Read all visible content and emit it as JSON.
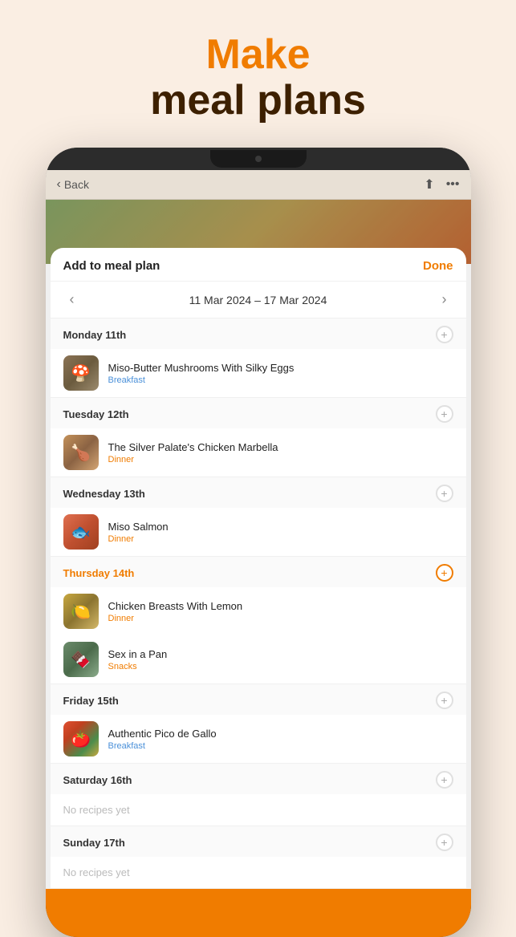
{
  "header": {
    "line1": "Make",
    "line2": "meal plans"
  },
  "app_bar": {
    "back_label": "Back",
    "share_icon": "share",
    "more_icon": "more"
  },
  "modal": {
    "title": "Add to meal plan",
    "done_label": "Done",
    "week_label": "11 Mar 2024 – 17 Mar 2024",
    "prev_arrow": "‹",
    "next_arrow": "›",
    "days": [
      {
        "id": "monday",
        "label": "Monday 11th",
        "is_highlighted": false,
        "recipes": [
          {
            "name": "Miso-Butter Mushrooms With Silky Eggs",
            "meal_type": "Breakfast",
            "meal_class": "meal-breakfast",
            "thumb_class": "thumb-mushroom",
            "emoji": "🍄"
          }
        ]
      },
      {
        "id": "tuesday",
        "label": "Tuesday 12th",
        "is_highlighted": false,
        "recipes": [
          {
            "name": "The Silver Palate's Chicken Marbella",
            "meal_type": "Dinner",
            "meal_class": "meal-dinner",
            "thumb_class": "thumb-chicken",
            "emoji": "🍗"
          }
        ]
      },
      {
        "id": "wednesday",
        "label": "Wednesday 13th",
        "is_highlighted": false,
        "recipes": [
          {
            "name": "Miso Salmon",
            "meal_type": "Dinner",
            "meal_class": "meal-dinner",
            "thumb_class": "thumb-salmon",
            "emoji": "🐟"
          }
        ]
      },
      {
        "id": "thursday",
        "label": "Thursday 14th",
        "is_highlighted": true,
        "recipes": [
          {
            "name": "Chicken Breasts With Lemon",
            "meal_type": "Dinner",
            "meal_class": "meal-dinner",
            "thumb_class": "thumb-lemon-chicken",
            "emoji": "🍋"
          },
          {
            "name": "Sex in a Pan",
            "meal_type": "Snacks",
            "meal_class": "meal-snacks",
            "thumb_class": "thumb-sex-in-pan",
            "emoji": "🍫"
          }
        ]
      },
      {
        "id": "friday",
        "label": "Friday 15th",
        "is_highlighted": false,
        "recipes": [
          {
            "name": "Authentic Pico de Gallo",
            "meal_type": "Breakfast",
            "meal_class": "meal-breakfast",
            "thumb_class": "thumb-pico",
            "emoji": "🍅"
          }
        ]
      },
      {
        "id": "saturday",
        "label": "Saturday 16th",
        "is_highlighted": false,
        "recipes": [],
        "empty_label": "No recipes yet"
      },
      {
        "id": "sunday",
        "label": "Sunday 17th",
        "is_highlighted": false,
        "recipes": [],
        "empty_label": "No recipes yet"
      }
    ]
  }
}
